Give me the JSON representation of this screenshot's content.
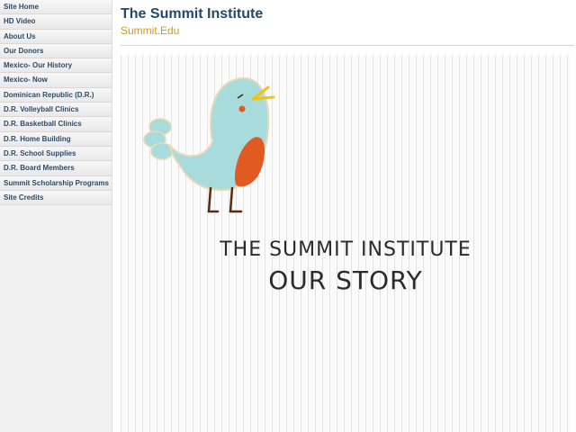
{
  "sidebar": {
    "items": [
      {
        "label": "Site Home"
      },
      {
        "label": "HD Video"
      },
      {
        "label": "About Us"
      },
      {
        "label": "Our Donors"
      },
      {
        "label": "Mexico- Our History"
      },
      {
        "label": "Mexico- Now"
      },
      {
        "label": "Dominican Republic (D.R.)"
      },
      {
        "label": "D.R. Volleyball Clinics"
      },
      {
        "label": "D.R. Basketball Clinics"
      },
      {
        "label": "D.R. Home Building"
      },
      {
        "label": "D.R. School Supplies"
      },
      {
        "label": "D.R. Board Members"
      },
      {
        "label": "Summit Scholarship Programs"
      },
      {
        "label": "Site Credits"
      }
    ]
  },
  "header": {
    "title": "The Summit Institute",
    "subtitle": "Summit.Edu"
  },
  "banner": {
    "line1": "THE SUMMIT INSTITUTE",
    "line2": "OUR STORY",
    "bird_icon": "bird-illustration",
    "colors": {
      "bird_body": "#a8dcdc",
      "bird_wing": "#e05a22",
      "bird_beak": "#f2c21b",
      "title_text": "#2b2b2b",
      "subtitle_text": "#d6980d",
      "header_text": "#234a6b"
    }
  }
}
